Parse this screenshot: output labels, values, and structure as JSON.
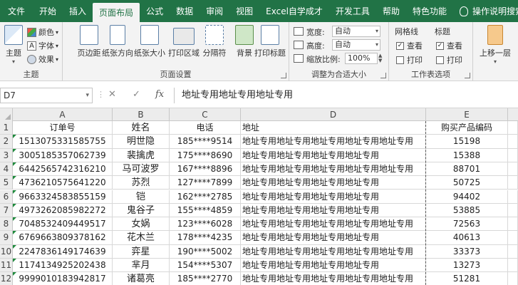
{
  "menu": {
    "tabs": [
      "文件",
      "开始",
      "插入",
      "页面布局",
      "公式",
      "数据",
      "审阅",
      "视图",
      "Excel自学成才",
      "开发工具",
      "帮助",
      "特色功能",
      "操作说明搜索"
    ],
    "active": "页面布局"
  },
  "ribbon": {
    "theme": {
      "main": "主题",
      "colors": "颜色",
      "fonts": "字体",
      "effects": "效果",
      "group": "主题"
    },
    "pagesetup": {
      "buttons": [
        "页边距",
        "纸张方向",
        "纸张大小",
        "打印区域",
        "分隔符",
        "背景",
        "打印标题"
      ],
      "group": "页面设置"
    },
    "scale": {
      "width_label": "宽度:",
      "width_value": "自动",
      "height_label": "高度:",
      "height_value": "自动",
      "scale_label": "缩放比例:",
      "scale_value": "100%",
      "group": "调整为合适大小"
    },
    "sheetopts": {
      "gridlines": "网格线",
      "headings": "标题",
      "view": "查看",
      "print": "打印",
      "group": "工作表选项"
    },
    "arrange": {
      "bring_forward": "上移一层"
    }
  },
  "formula_bar": {
    "name_box": "D7",
    "cancel": "✕",
    "enter": "✓",
    "fx": "fx",
    "content": "地址专用地址专用地址专用"
  },
  "grid": {
    "columns": [
      "A",
      "B",
      "C",
      "D",
      "E"
    ],
    "row_numbers": [
      "1",
      "2",
      "3",
      "4",
      "5",
      "6",
      "7",
      "8",
      "9",
      "10",
      "11",
      "12"
    ],
    "header_row": [
      "订单号",
      "姓名",
      "电话",
      "地址",
      "购买产品编码"
    ],
    "rows": [
      [
        "1513075331585755",
        "明世隐",
        "185****9514",
        "地址专用地址专用地址专用地址专用地址专用",
        "15198"
      ],
      [
        "3005185357062739",
        "裴擒虎",
        "175****8690",
        "地址专用地址专用地址专用地址专用",
        "15388"
      ],
      [
        "6442565742316210",
        "马可波罗",
        "167****8896",
        "地址专用地址专用地址专用地址专用地址专用",
        "88701"
      ],
      [
        "4736210575641220",
        "苏烈",
        "127****7899",
        "地址专用地址专用地址专用地址专用",
        "50725"
      ],
      [
        "9663324583855159",
        "铠",
        "162****2785",
        "地址专用地址专用地址专用地址专用",
        "94402"
      ],
      [
        "4973262085982272",
        "鬼谷子",
        "155****4859",
        "地址专用地址专用地址专用地址专用",
        "53885"
      ],
      [
        "7048532409449517",
        "女娲",
        "123****6028",
        "地址专用地址专用地址专用地址专用地址专用",
        "72563"
      ],
      [
        "6769663809378162",
        "花木兰",
        "178****4235",
        "地址专用地址专用地址专用地址专用",
        "40613"
      ],
      [
        "2247836149174639",
        "弈星",
        "190****5002",
        "地址专用地址专用地址专用地址专用地址专用",
        "33373"
      ],
      [
        "1174134925202438",
        "芈月",
        "154****5307",
        "地址专用地址专用地址专用地址专用",
        "13273"
      ],
      [
        "9999010183942817",
        "诸葛亮",
        "185****2770",
        "地址专用地址专用地址专用地址专用地址专用",
        "51281"
      ]
    ]
  },
  "colors": {
    "accent": "#217346",
    "ribbon_bg": "#f3f3f3",
    "header_bg": "#ececec"
  }
}
